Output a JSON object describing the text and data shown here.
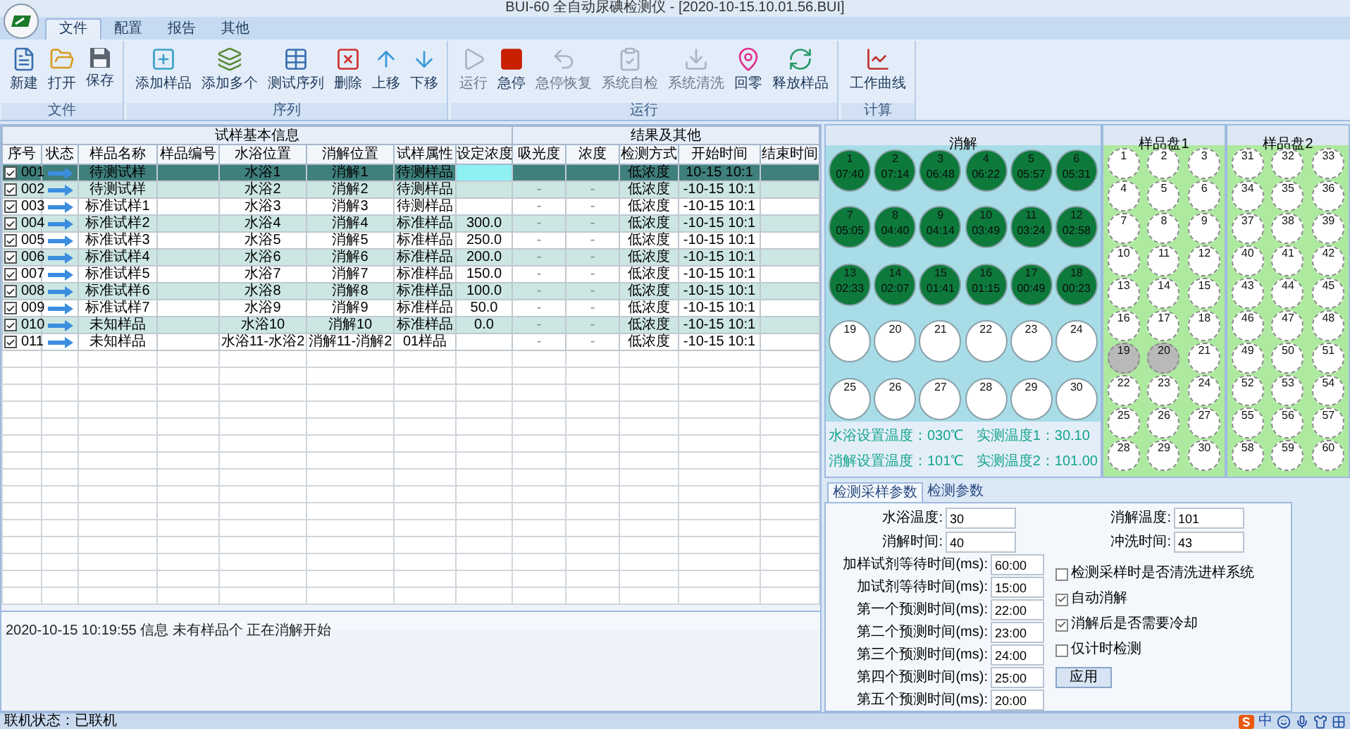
{
  "window": {
    "title": "BUI-60 全自动尿碘检测仪 - [2020-10-15.10.01.56.BUI]"
  },
  "ribbon": {
    "tabs": [
      {
        "label": "文件",
        "selected": true
      },
      {
        "label": "配置",
        "selected": false
      },
      {
        "label": "报告",
        "selected": false
      },
      {
        "label": "其他",
        "selected": false
      }
    ],
    "groups": [
      {
        "label": "文件",
        "items": [
          {
            "label": "新建",
            "kind": "new",
            "disabled": false
          },
          {
            "label": "打开",
            "kind": "open",
            "disabled": false
          },
          {
            "label": "保存",
            "kind": "save",
            "disabled": false
          }
        ]
      },
      {
        "label": "序列",
        "items": [
          {
            "label": "添加样品",
            "kind": "add",
            "disabled": false
          },
          {
            "label": "添加多个",
            "kind": "addmany",
            "disabled": false
          },
          {
            "label": "测试序列",
            "kind": "table",
            "disabled": false
          },
          {
            "label": "删除",
            "kind": "delete",
            "disabled": false
          },
          {
            "label": "上移",
            "kind": "up",
            "disabled": false
          },
          {
            "label": "下移",
            "kind": "down",
            "disabled": false
          }
        ]
      },
      {
        "label": "运行",
        "items": [
          {
            "label": "运行",
            "kind": "play",
            "disabled": true
          },
          {
            "label": "急停",
            "kind": "stop",
            "disabled": false
          },
          {
            "label": "急停恢复",
            "kind": "resume",
            "disabled": true
          },
          {
            "label": "系统自检",
            "kind": "check",
            "disabled": true
          },
          {
            "label": "系统清洗",
            "kind": "clean",
            "disabled": true
          },
          {
            "label": "回零",
            "kind": "home",
            "disabled": false
          },
          {
            "label": "释放样品",
            "kind": "release",
            "disabled": false
          }
        ]
      },
      {
        "label": "计算",
        "items": [
          {
            "label": "工作曲线",
            "kind": "curve",
            "disabled": false
          }
        ]
      }
    ]
  },
  "table": {
    "column_groups": [
      {
        "label": "试样基本信息",
        "columns": [
          "序号",
          "状态",
          "样品名称",
          "样品编号",
          "水浴位置",
          "消解位置",
          "试样属性",
          "设定浓度"
        ]
      },
      {
        "label": "结果及其他",
        "columns": [
          "吸光度",
          "浓度",
          "检测方式",
          "开始时间",
          "结束时间"
        ]
      }
    ],
    "rows": [
      {
        "checked": true,
        "selected": true,
        "cells": [
          "001",
          "待测试样",
          null,
          "水浴1",
          "消解1",
          "待测样品",
          null,
          null,
          null,
          "低浓度",
          "10-15 10:1",
          null
        ]
      },
      {
        "checked": true,
        "selected": false,
        "cells": [
          "002",
          "待测试样",
          null,
          "水浴2",
          "消解2",
          "待测样品",
          null,
          "-",
          "-",
          "低浓度",
          "-10-15 10:1",
          null
        ]
      },
      {
        "checked": true,
        "selected": false,
        "cells": [
          "003",
          "标准试样1",
          null,
          "水浴3",
          "消解3",
          "待测样品",
          null,
          "-",
          "-",
          "低浓度",
          "-10-15 10:1",
          null
        ]
      },
      {
        "checked": true,
        "selected": false,
        "cells": [
          "004",
          "标准试样2",
          null,
          "水浴4",
          "消解4",
          "标准样品",
          "300.0",
          "-",
          "-",
          "低浓度",
          "-10-15 10:1",
          null
        ]
      },
      {
        "checked": true,
        "selected": false,
        "cells": [
          "005",
          "标准试样3",
          null,
          "水浴5",
          "消解5",
          "标准样品",
          "250.0",
          "-",
          "-",
          "低浓度",
          "-10-15 10:1",
          null
        ]
      },
      {
        "checked": true,
        "selected": false,
        "cells": [
          "006",
          "标准试样4",
          null,
          "水浴6",
          "消解6",
          "标准样品",
          "200.0",
          "-",
          "-",
          "低浓度",
          "-10-15 10:1",
          null
        ]
      },
      {
        "checked": true,
        "selected": false,
        "cells": [
          "007",
          "标准试样5",
          null,
          "水浴7",
          "消解7",
          "标准样品",
          "150.0",
          "-",
          "-",
          "低浓度",
          "-10-15 10:1",
          null
        ]
      },
      {
        "checked": true,
        "selected": false,
        "cells": [
          "008",
          "标准试样6",
          null,
          "水浴8",
          "消解8",
          "标准样品",
          "100.0",
          "-",
          "-",
          "低浓度",
          "-10-15 10:1",
          null
        ]
      },
      {
        "checked": true,
        "selected": false,
        "cells": [
          "009",
          "标准试样7",
          null,
          "水浴9",
          "消解9",
          "标准样品",
          "50.0",
          "-",
          "-",
          "低浓度",
          "-10-15 10:1",
          null
        ]
      },
      {
        "checked": true,
        "selected": false,
        "cells": [
          "010",
          "未知样品",
          null,
          "水浴10",
          "消解10",
          "标准样品",
          "0.0",
          "-",
          "-",
          "低浓度",
          "-10-15 10:1",
          null
        ]
      },
      {
        "checked": true,
        "selected": false,
        "cells": [
          "011",
          "未知样品",
          null,
          "水浴11-水浴2",
          "消解11-消解2",
          "01样品",
          null,
          "-",
          "-",
          "低浓度",
          "-10-15 10:1",
          null
        ]
      }
    ]
  },
  "log": "2020-10-15 10:19:55   信息 未有样品个 正在消解开始",
  "digest": {
    "title": "消解",
    "wells": [
      {
        "number": "1",
        "time": "07:40",
        "active": true
      },
      {
        "number": "2",
        "time": "07:14",
        "active": true
      },
      {
        "number": "3",
        "time": "06:48",
        "active": true
      },
      {
        "number": "4",
        "time": "06:22",
        "active": true
      },
      {
        "number": "5",
        "time": "05:57",
        "active": true
      },
      {
        "number": "6",
        "time": "05:31",
        "active": true
      },
      {
        "number": "7",
        "time": "05:05",
        "active": true
      },
      {
        "number": "8",
        "time": "04:40",
        "active": true
      },
      {
        "number": "9",
        "time": "04:14",
        "active": true
      },
      {
        "number": "10",
        "time": "03:49",
        "active": true
      },
      {
        "number": "11",
        "time": "03:24",
        "active": true
      },
      {
        "number": "12",
        "time": "02:58",
        "active": true
      },
      {
        "number": "13",
        "time": "02:33",
        "active": true
      },
      {
        "number": "14",
        "time": "02:07",
        "active": true
      },
      {
        "number": "15",
        "time": "01:41",
        "active": true
      },
      {
        "number": "16",
        "time": "01:15",
        "active": true
      },
      {
        "number": "17",
        "time": "00:49",
        "active": true
      },
      {
        "number": "18",
        "time": "00:23",
        "active": true
      },
      {
        "number": "19",
        "active": false
      },
      {
        "number": "20",
        "active": false
      },
      {
        "number": "21",
        "active": false
      },
      {
        "number": "22",
        "active": false
      },
      {
        "number": "23",
        "active": false
      },
      {
        "number": "24",
        "active": false
      },
      {
        "number": "25",
        "active": false
      },
      {
        "number": "26",
        "active": false
      },
      {
        "number": "27",
        "active": false
      },
      {
        "number": "28",
        "active": false
      },
      {
        "number": "29",
        "active": false
      },
      {
        "number": "30",
        "active": false
      }
    ],
    "readings": [
      "水浴设置温度：030℃",
      "实测温度1：30.10",
      "消解设置温度：101℃",
      "实测温度2：101.00"
    ]
  },
  "plates": [
    {
      "title": "样品盘1",
      "wells": [
        {
          "number": "1",
          "filled": false
        },
        {
          "number": "2",
          "filled": false
        },
        {
          "number": "3",
          "filled": false
        },
        {
          "number": "4",
          "filled": false
        },
        {
          "number": "5",
          "filled": false
        },
        {
          "number": "6",
          "filled": false
        },
        {
          "number": "7",
          "filled": false
        },
        {
          "number": "8",
          "filled": false
        },
        {
          "number": "9",
          "filled": false
        },
        {
          "number": "10",
          "filled": false
        },
        {
          "number": "11",
          "filled": false
        },
        {
          "number": "12",
          "filled": false
        },
        {
          "number": "13",
          "filled": false
        },
        {
          "number": "14",
          "filled": false
        },
        {
          "number": "15",
          "filled": false
        },
        {
          "number": "16",
          "filled": false
        },
        {
          "number": "17",
          "filled": false
        },
        {
          "number": "18",
          "filled": false
        },
        {
          "number": "19",
          "filled": true
        },
        {
          "number": "20",
          "filled": true
        },
        {
          "number": "21",
          "filled": false
        },
        {
          "number": "22",
          "filled": false
        },
        {
          "number": "23",
          "filled": false
        },
        {
          "number": "24",
          "filled": false
        },
        {
          "number": "25",
          "filled": false
        },
        {
          "number": "26",
          "filled": false
        },
        {
          "number": "27",
          "filled": false
        },
        {
          "number": "28",
          "filled": false
        },
        {
          "number": "29",
          "filled": false
        },
        {
          "number": "30",
          "filled": false
        }
      ]
    },
    {
      "title": "样品盘2",
      "wells": [
        {
          "number": "31",
          "filled": false
        },
        {
          "number": "32",
          "filled": false
        },
        {
          "number": "33",
          "filled": false
        },
        {
          "number": "34",
          "filled": false
        },
        {
          "number": "35",
          "filled": false
        },
        {
          "number": "36",
          "filled": false
        },
        {
          "number": "37",
          "filled": false
        },
        {
          "number": "38",
          "filled": false
        },
        {
          "number": "39",
          "filled": false
        },
        {
          "number": "40",
          "filled": false
        },
        {
          "number": "41",
          "filled": false
        },
        {
          "number": "42",
          "filled": false
        },
        {
          "number": "43",
          "filled": false
        },
        {
          "number": "44",
          "filled": false
        },
        {
          "number": "45",
          "filled": false
        },
        {
          "number": "46",
          "filled": false
        },
        {
          "number": "47",
          "filled": false
        },
        {
          "number": "48",
          "filled": false
        },
        {
          "number": "49",
          "filled": false
        },
        {
          "number": "50",
          "filled": false
        },
        {
          "number": "51",
          "filled": false
        },
        {
          "number": "52",
          "filled": false
        },
        {
          "number": "53",
          "filled": false
        },
        {
          "number": "54",
          "filled": false
        },
        {
          "number": "55",
          "filled": false
        },
        {
          "number": "56",
          "filled": false
        },
        {
          "number": "57",
          "filled": false
        },
        {
          "number": "58",
          "filled": false
        },
        {
          "number": "59",
          "filled": false
        },
        {
          "number": "60",
          "filled": false
        }
      ]
    }
  ],
  "settings": {
    "tabs": [
      {
        "label": "检测采样参数",
        "selected": true
      },
      {
        "label": "检测参数",
        "selected": false
      }
    ],
    "pair_fields": [
      {
        "label": "水浴温度:",
        "value": "30"
      },
      {
        "label": "消解温度:",
        "value": "101"
      },
      {
        "label": "消解时间:",
        "value": "40"
      },
      {
        "label": "冲洗时间:",
        "value": "43"
      }
    ],
    "time_fields": [
      {
        "label": "加样试剂等待时间(ms):",
        "value": "60:00"
      },
      {
        "label": "加试剂等待时间(ms):",
        "value": "15:00"
      },
      {
        "label": "第一个预测时间(ms):",
        "value": "22:00"
      },
      {
        "label": "第二个预测时间(ms):",
        "value": "23:00"
      },
      {
        "label": "第三个预测时间(ms):",
        "value": "24:00"
      },
      {
        "label": "第四个预测时间(ms):",
        "value": "25:00"
      },
      {
        "label": "第五个预测时间(ms):",
        "value": "20:00"
      }
    ],
    "checkboxes": [
      {
        "label": "检测采样时是否清洗进样系统",
        "checked": false
      },
      {
        "label": "自动消解",
        "checked": true
      },
      {
        "label": "消解后是否需要冷却",
        "checked": true
      },
      {
        "label": "仅计时检测",
        "checked": false
      }
    ],
    "button": "应用"
  },
  "status_bar": {
    "text": "联机状态：已联机",
    "ime": "中"
  }
}
